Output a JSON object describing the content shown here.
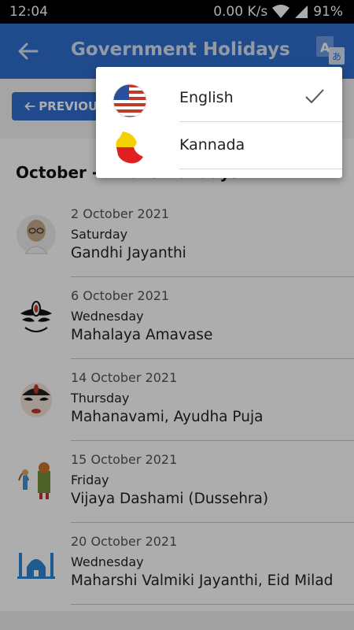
{
  "status": {
    "time": "12:04",
    "speed": "0.00 K/s",
    "battery": "91%"
  },
  "appbar": {
    "title": "Government Holidays",
    "back_icon": "arrow-back-icon",
    "translate_icon": "translate-icon"
  },
  "nav": {
    "previous_label": "PREVIOUS"
  },
  "month_header": "October - Public Holidays",
  "holidays": [
    {
      "date": "2 October 2021",
      "day": "Saturday",
      "name": "Gandhi Jayanthi",
      "icon": "gandhi-portrait-icon"
    },
    {
      "date": "6 October 2021",
      "day": "Wednesday",
      "name": "Mahalaya Amavase",
      "icon": "durga-face-icon"
    },
    {
      "date": "14 October 2021",
      "day": "Thursday",
      "name": "Mahanavami, Ayudha Puja",
      "icon": "goddess-face-icon"
    },
    {
      "date": "15 October 2021",
      "day": "Friday",
      "name": "Vijaya Dashami (Dussehra)",
      "icon": "rama-ravana-icon"
    },
    {
      "date": "20 October 2021",
      "day": "Wednesday",
      "name": "Maharshi Valmiki Jayanthi, Eid Milad",
      "icon": "mosque-icon"
    }
  ],
  "language_menu": {
    "options": [
      {
        "label": "English",
        "flag": "us-flag-icon",
        "selected": true
      },
      {
        "label": "Kannada",
        "flag": "karnataka-map-icon",
        "selected": false
      }
    ]
  },
  "colors": {
    "primary": "#2f6fce",
    "status_bar": "#000000"
  }
}
